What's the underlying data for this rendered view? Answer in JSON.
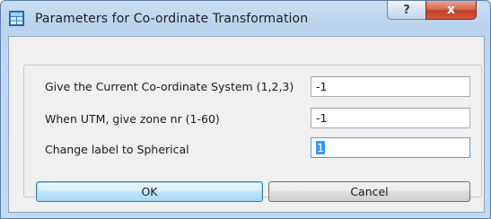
{
  "window": {
    "title": "Parameters for Co-ordinate Transformation",
    "help_label": "?",
    "close_label": "x"
  },
  "form": {
    "rows": [
      {
        "label": "Give the Current Co-ordinate System (1,2,3)",
        "value": "-1"
      },
      {
        "label": "When UTM, give zone nr (1-60)",
        "value": "-1"
      },
      {
        "label": "Change label to Spherical",
        "value": "1"
      }
    ]
  },
  "buttons": {
    "ok_label": "OK",
    "cancel_label": "Cancel"
  },
  "icons": {
    "app": "grid-window-icon",
    "help": "question-mark-icon",
    "close": "close-x-icon"
  },
  "colors": {
    "titlebar": "#bdd6f0",
    "close_button": "#c9452d",
    "focus_border": "#5b9bd8",
    "selection": "#3399ff"
  }
}
